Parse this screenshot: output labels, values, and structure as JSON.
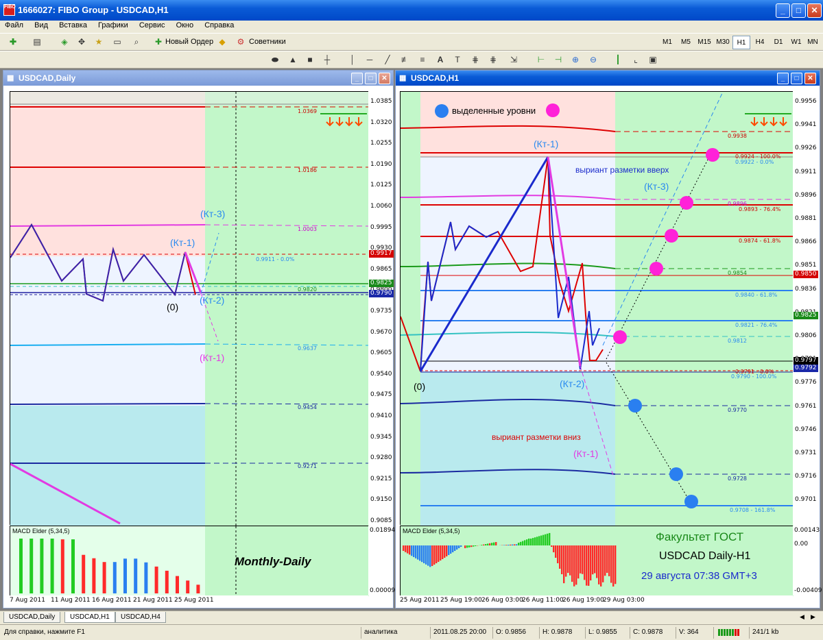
{
  "window": {
    "title": "1666027: FIBO Group - USDCAD,H1",
    "app_icon_text": "FIBO"
  },
  "menu": [
    "Файл",
    "Вид",
    "Вставка",
    "Графики",
    "Сервис",
    "Окно",
    "Справка"
  ],
  "toolbar": {
    "new_order": "Новый Ордер",
    "advisors": "Советники",
    "text_tool": "A"
  },
  "timeframes": [
    "M1",
    "M5",
    "M15",
    "M30",
    "H1",
    "H4",
    "D1",
    "W1",
    "MN"
  ],
  "active_timeframe": "H1",
  "left_chart": {
    "title": "USDCAD,Daily",
    "price_ticks": [
      "1.0385",
      "1.0320",
      "1.0255",
      "1.0190",
      "1.0125",
      "1.0060",
      "0.9995",
      "0.9930",
      "0.9865",
      "0.9800",
      "0.9735",
      "0.9670",
      "0.9605",
      "0.9540",
      "0.9475",
      "0.9410",
      "0.9345",
      "0.9280",
      "0.9215",
      "0.9150",
      "0.9085"
    ],
    "price_labels": [
      {
        "text": "0.9917",
        "color": "#d40000"
      },
      {
        "text": "0.9825",
        "color": "#1a8a1a"
      },
      {
        "text": "0.9790",
        "color": "#1a28a8"
      }
    ],
    "fib_labels": [
      "1.0369",
      "1.0186",
      "1.0003",
      "0.9911 - 0.0%",
      "0.9820",
      "0.9637",
      "0.9454",
      "0.9271"
    ],
    "wave_labels": [
      "(Кт-3)",
      "(Кт-1)",
      "(Кт-2)",
      "(0)",
      "(Кт-1)"
    ],
    "date_ticks": [
      "7 Aug 2011",
      "11 Aug 2011",
      "16 Aug 2011",
      "21 Aug 2011",
      "25 Aug 2011"
    ],
    "macd_title": "MACD Elder (5,34,5)",
    "macd_ticks": [
      "0.01894",
      "0.00009"
    ],
    "macd_values": [
      0.0145,
      0.0145,
      0.0145,
      0.0145,
      0.0143,
      0.0143,
      0.0102,
      0.0093,
      0.0083,
      0.0083,
      0.0092,
      0.0092,
      0.0082,
      0.0071,
      0.006,
      0.0046,
      0.0034,
      0.0023
    ],
    "macd_colors": [
      "#22cc22",
      "#22cc22",
      "#22cc22",
      "#22cc22",
      "#ff2a2a",
      "#22cc22",
      "#ff2a2a",
      "#ff2a2a",
      "#ff2a2a",
      "#2a7ff0",
      "#2a7ff0",
      "#2a7ff0",
      "#2a7ff0",
      "#ff2a2a",
      "#ff2a2a",
      "#ff2a2a",
      "#ff2a2a",
      "#ff2a2a"
    ],
    "caption": "Monthly-Daily"
  },
  "right_chart": {
    "title": "USDCAD,H1",
    "price_ticks": [
      "0.9956",
      "0.9941",
      "0.9926",
      "0.9911",
      "0.9896",
      "0.9881",
      "0.9866",
      "0.9851",
      "0.9836",
      "0.9821",
      "0.9806",
      "0.9791",
      "0.9776",
      "0.9761",
      "0.9746",
      "0.9731",
      "0.9716",
      "0.9701"
    ],
    "price_labels": [
      {
        "text": "0.9850",
        "color": "#d40000"
      },
      {
        "text": "0.9825",
        "color": "#1a8a1a"
      },
      {
        "text": "0.9797",
        "color": "#000000"
      },
      {
        "text": "0.9792",
        "color": "#1a28a8"
      }
    ],
    "fib_labels": [
      "0.9938",
      "0.9924 - 100.0%",
      "0.9922 - 0.0%",
      "0.9896",
      "0.9893 - 76.4%",
      "0.9874 - 61.8%",
      "0.9854",
      "0.9840 - 61.8%",
      "0.9821 - 76.4%",
      "0.9812",
      "0.9791 - 0.0%",
      "0.9790 - 100.0%",
      "0.9770",
      "0.9728",
      "0.9708 - 161.8%"
    ],
    "legend": "выделенные уровни",
    "wave_labels": [
      "(Кт-1)",
      "(Кт-3)",
      "(Кт-2)",
      "(0)",
      "(Кт-1)"
    ],
    "variant_up": "выриант разметки вверх",
    "variant_down": "выриант разметки вниз",
    "date_ticks": [
      "25 Aug 2011",
      "25 Aug 19:00",
      "26 Aug 03:00",
      "26 Aug 11:00",
      "26 Aug 19:00",
      "29 Aug 03:00"
    ],
    "macd_title": "MACD Elder (5,34,5)",
    "macd_ticks": [
      "0.00143",
      "0.00",
      "-0.00409"
    ]
  },
  "overlay": {
    "faculty": "Факультет ГОСТ",
    "pair": "USDCAD Daily-H1",
    "datetime": "29 августа 07:38 GMT+3"
  },
  "tabs": [
    "USDCAD,Daily",
    "USDCAD,H1",
    "USDCAD,H4"
  ],
  "status": {
    "help": "Для справки, нажмите F1",
    "profile": "аналитика",
    "datetime": "2011.08.25 20:00",
    "open": "O: 0.9856",
    "high": "H: 0.9878",
    "low": "L: 0.9855",
    "close": "C: 0.9878",
    "volume": "V: 364",
    "traffic": "241/1 kb"
  }
}
